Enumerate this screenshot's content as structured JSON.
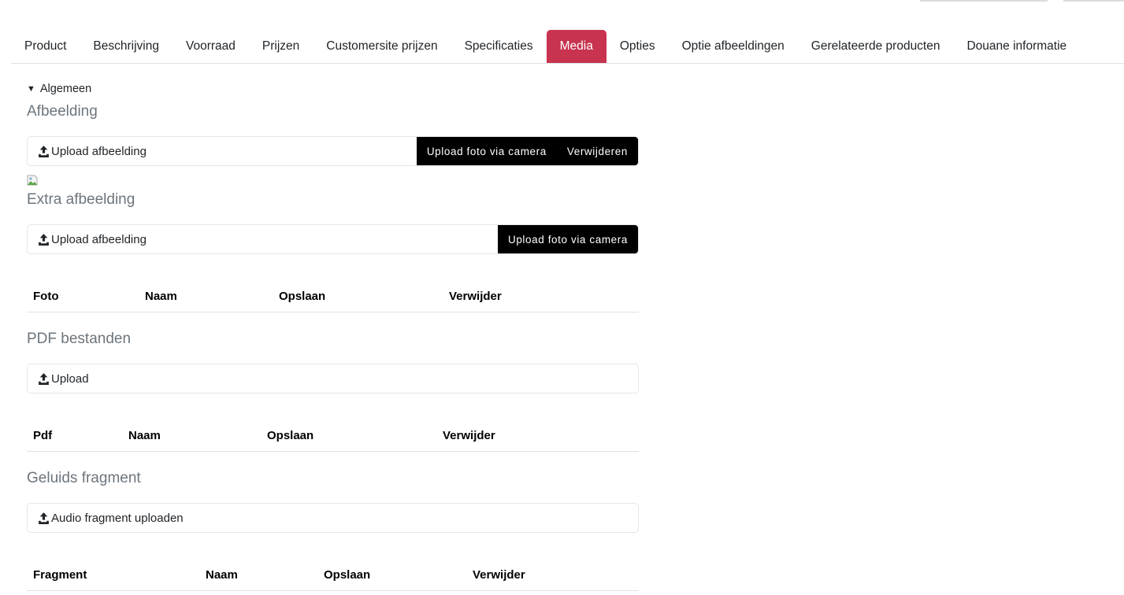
{
  "tabs": [
    {
      "label": "Product",
      "active": false
    },
    {
      "label": "Beschrijving",
      "active": false
    },
    {
      "label": "Voorraad",
      "active": false
    },
    {
      "label": "Prijzen",
      "active": false
    },
    {
      "label": "Customersite prijzen",
      "active": false
    },
    {
      "label": "Specificaties",
      "active": false
    },
    {
      "label": "Media",
      "active": true
    },
    {
      "label": "Opties",
      "active": false
    },
    {
      "label": "Optie afbeeldingen",
      "active": false
    },
    {
      "label": "Gerelateerde producten",
      "active": false
    },
    {
      "label": "Douane informatie",
      "active": false
    }
  ],
  "colors": {
    "active_tab": "#c8334f",
    "button_bg": "#000000"
  },
  "general": {
    "summary_label": "Algemeen",
    "summary_icon": "triangle-down-icon"
  },
  "image": {
    "title": "Afbeelding",
    "upload_label": "Upload afbeelding",
    "camera_button": "Upload foto via camera",
    "delete_button": "Verwijderen",
    "preview_icon": "broken-image-icon"
  },
  "extra_image": {
    "title": "Extra afbeelding",
    "upload_label": "Upload afbeelding",
    "camera_button": "Upload foto via camera",
    "table_headers": [
      "Foto",
      "Naam",
      "Opslaan",
      "Verwijder"
    ]
  },
  "pdf": {
    "title": "PDF bestanden",
    "upload_label": "Upload",
    "table_headers": [
      "Pdf",
      "Naam",
      "Opslaan",
      "Verwijder"
    ]
  },
  "audio": {
    "title": "Geluids fragment",
    "upload_label": "Audio fragment uploaden",
    "table_headers": [
      "Fragment",
      "Naam",
      "Opslaan",
      "Verwijder"
    ]
  }
}
